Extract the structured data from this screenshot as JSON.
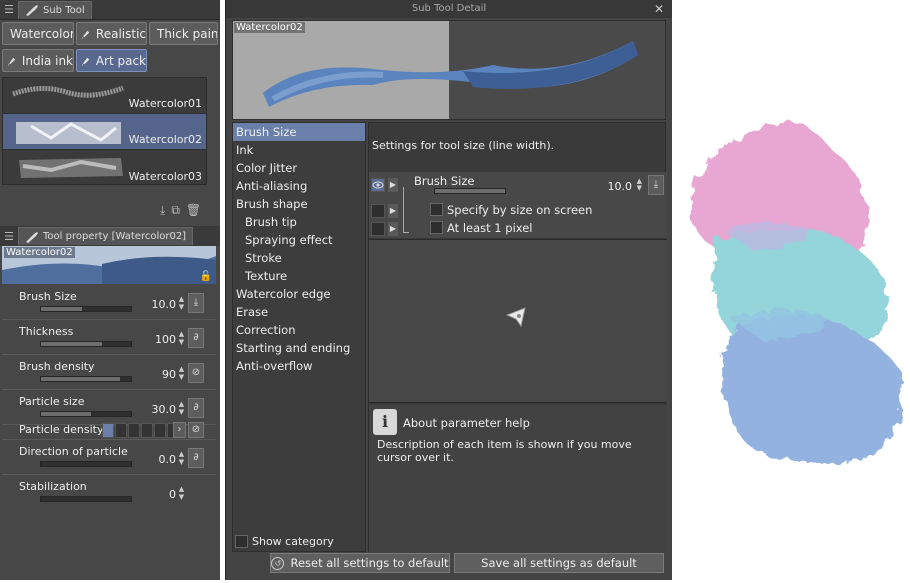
{
  "sub_tool": {
    "tab_label": "Sub Tool",
    "buttons": [
      {
        "label": "Watercolor",
        "icon": "pen-nib-icon",
        "active": false
      },
      {
        "label": "Realistic",
        "icon": "pen-nib-icon",
        "active": false
      },
      {
        "label": "Thick paint",
        "icon": "thick-brush-icon",
        "active": false
      },
      {
        "label": "India ink",
        "icon": "pen-nib-icon",
        "active": false
      },
      {
        "label": "Art pack",
        "icon": "pen-nib-icon",
        "active": true
      }
    ],
    "brushes": [
      {
        "name": "Watercolor01",
        "active": false
      },
      {
        "name": "Watercolor02",
        "active": true
      },
      {
        "name": "Watercolor03",
        "active": false
      }
    ]
  },
  "tool_property": {
    "tab_label": "Tool property [Watercolor02]",
    "preview_label": "Watercolor02",
    "rows": [
      {
        "label": "Brush Size",
        "value": "10.0",
        "fill": 0.45,
        "button": "download-icon"
      },
      {
        "label": "Thickness",
        "value": "100",
        "fill": 0.68,
        "button": "pressure-icon"
      },
      {
        "label": "Brush density",
        "value": "90",
        "fill": 0.88,
        "button": "toggle-icon"
      },
      {
        "label": "Particle size",
        "value": "30.0",
        "fill": 0.55,
        "button": "pressure-icon"
      },
      {
        "label": "Particle density",
        "value": "",
        "fill": 0.0,
        "button": "toggle-icon"
      },
      {
        "label": "Direction of particle",
        "value": "0.0",
        "fill": 0.0,
        "button": "pressure-icon"
      },
      {
        "label": "Stabilization",
        "value": "0",
        "fill": 0.0,
        "button": ""
      }
    ]
  },
  "dialog": {
    "title": "Sub Tool Detail",
    "preview_label": "Watercolor02",
    "categories": [
      {
        "label": "Brush Size",
        "sub": false,
        "active": true
      },
      {
        "label": "Ink",
        "sub": false,
        "active": false
      },
      {
        "label": "Color Jitter",
        "sub": false,
        "active": false
      },
      {
        "label": "Anti-aliasing",
        "sub": false,
        "active": false
      },
      {
        "label": "Brush shape",
        "sub": false,
        "active": false
      },
      {
        "label": "Brush tip",
        "sub": true,
        "active": false
      },
      {
        "label": "Spraying effect",
        "sub": true,
        "active": false
      },
      {
        "label": "Stroke",
        "sub": true,
        "active": false
      },
      {
        "label": "Texture",
        "sub": true,
        "active": false
      },
      {
        "label": "Watercolor edge",
        "sub": false,
        "active": false
      },
      {
        "label": "Erase",
        "sub": false,
        "active": false
      },
      {
        "label": "Correction",
        "sub": false,
        "active": false
      },
      {
        "label": "Starting and ending",
        "sub": false,
        "active": false
      },
      {
        "label": "Anti-overflow",
        "sub": false,
        "active": false
      }
    ],
    "show_category": "Show category",
    "settings_desc": "Settings for tool size (line width).",
    "brush_size_label": "Brush Size",
    "brush_size_value": "10.0",
    "specify_label": "Specify by size on screen",
    "atleast_label": "At least 1 pixel",
    "help_title": "About parameter help",
    "help_body": "Description of each item is shown if you move cursor over it.",
    "reset_btn": "Reset all settings to default",
    "save_btn": "Save all settings as default"
  },
  "colors": {
    "accent": "#6b7fab",
    "panel": "#474747",
    "pink": "#e6a3d0",
    "teal": "#8fd3da",
    "blue": "#8eaede"
  }
}
